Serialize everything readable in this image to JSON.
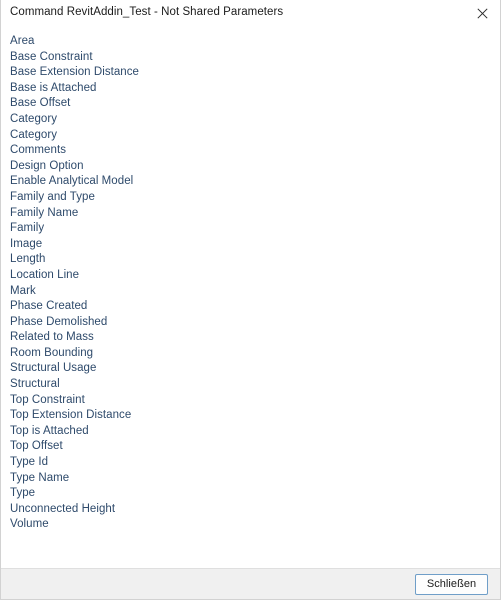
{
  "window": {
    "title": "Command RevitAddin_Test - Not Shared Parameters",
    "close_icon": "close-icon",
    "border_color": "#d2d2d2"
  },
  "colors": {
    "title_text": "#1b1b1b",
    "list_text": "#2e4a6b",
    "footer_background": "#f0f0f0",
    "button_border": "#6f9ec8"
  },
  "list": {
    "items": [
      "Area",
      "Base Constraint",
      "Base Extension Distance",
      "Base is Attached",
      "Base Offset",
      "Category",
      "Category",
      "Comments",
      "Design Option",
      "Enable Analytical Model",
      "Family and Type",
      "Family Name",
      "Family",
      "Image",
      "Length",
      "Location Line",
      "Mark",
      "Phase Created",
      "Phase Demolished",
      "Related to Mass",
      "Room Bounding",
      "Structural Usage",
      "Structural",
      "Top Constraint",
      "Top Extension Distance",
      "Top is Attached",
      "Top Offset",
      "Type Id",
      "Type Name",
      "Type",
      "Unconnected Height",
      "Volume"
    ]
  },
  "footer": {
    "close_label": "Schließen"
  }
}
